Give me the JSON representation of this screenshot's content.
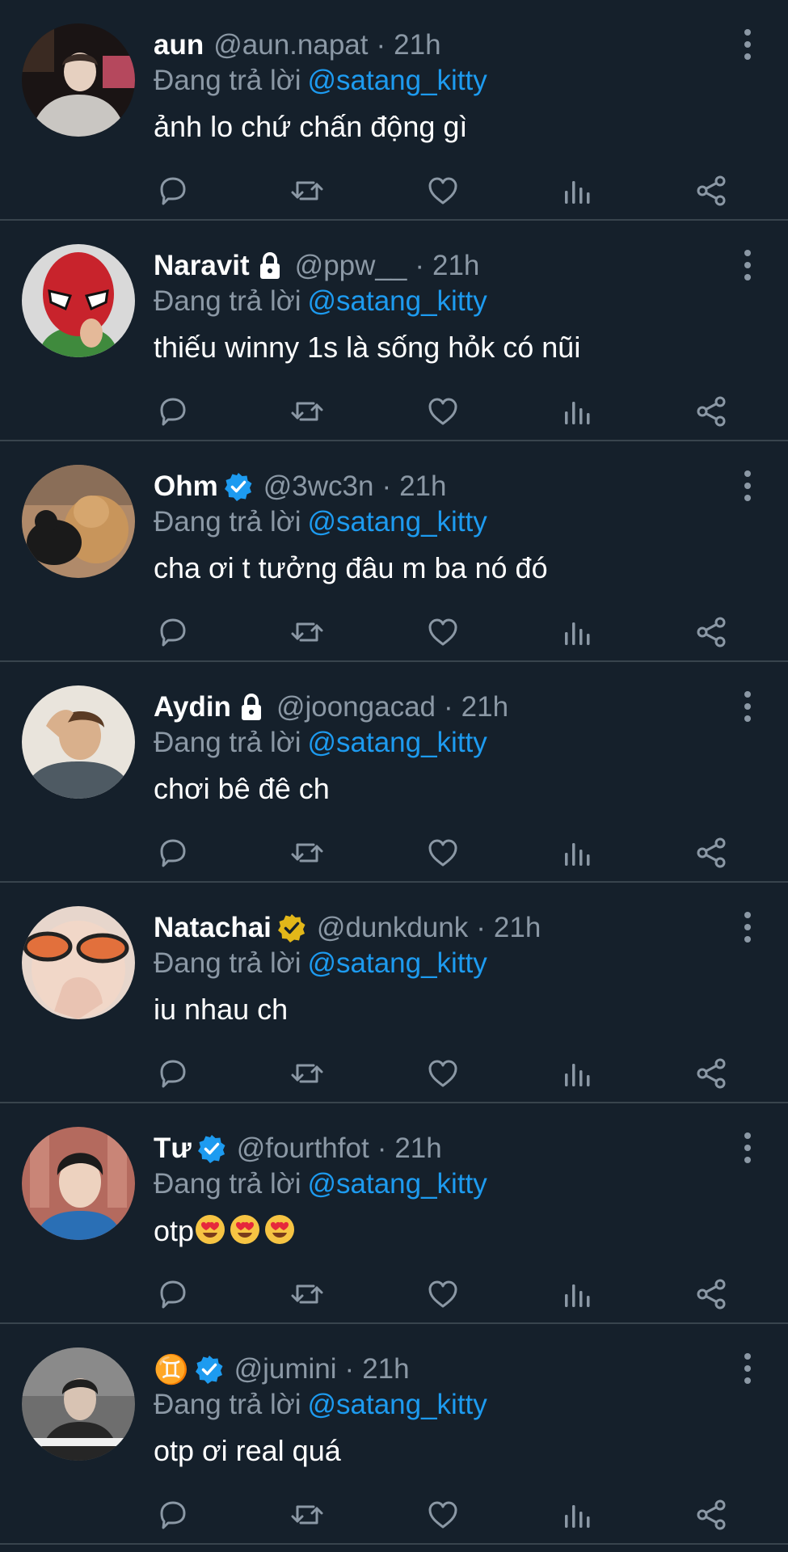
{
  "replying_prefix": "Đang trả lời",
  "replying_to": "@satang_kitty",
  "separator": "·",
  "colors": {
    "background": "#15202b",
    "divider": "#38444d",
    "secondary_text": "#8b98a5",
    "mention": "#1d9bf0",
    "verified_blue": "#1d9bf0",
    "verified_gold": "#e2b719"
  },
  "tweets": [
    {
      "name": "aun",
      "badge": "none",
      "handle": "@aun.napat",
      "time": "21h",
      "text": "ảnh lo chứ chấn động gì",
      "emoji_count": 0
    },
    {
      "name": "Naravit",
      "badge": "lock-icon",
      "handle": "@ppw__",
      "time": "21h",
      "text": "thiếu winny 1s là sống hỏk có nũi",
      "emoji_count": 0
    },
    {
      "name": "Ohm",
      "badge": "verified-blue-icon",
      "handle": "@3wc3n",
      "time": "21h",
      "text": "cha ơi t tưởng đâu m ba nó đó",
      "emoji_count": 0
    },
    {
      "name": "Aydin",
      "badge": "lock-icon",
      "handle": "@joongacad",
      "time": "21h",
      "text": "chơi bê đê ch",
      "emoji_count": 0
    },
    {
      "name": "Natachai",
      "badge": "verified-gold-icon",
      "handle": "@dunkdunk",
      "time": "21h",
      "text": "iu nhau ch",
      "emoji_count": 0
    },
    {
      "name": "Tư",
      "badge": "verified-blue-icon",
      "handle": "@fourthfot",
      "time": "21h",
      "text": "otp",
      "emoji_count": 3,
      "emoji": "heart-eyes-emoji"
    },
    {
      "name": "♊",
      "badge": "verified-blue-icon",
      "handle": "@jumini",
      "time": "21h",
      "text": "otp ơi real quá",
      "emoji_count": 0
    }
  ],
  "actions": [
    "reply-icon",
    "retweet-icon",
    "like-icon",
    "views-icon",
    "share-icon"
  ]
}
